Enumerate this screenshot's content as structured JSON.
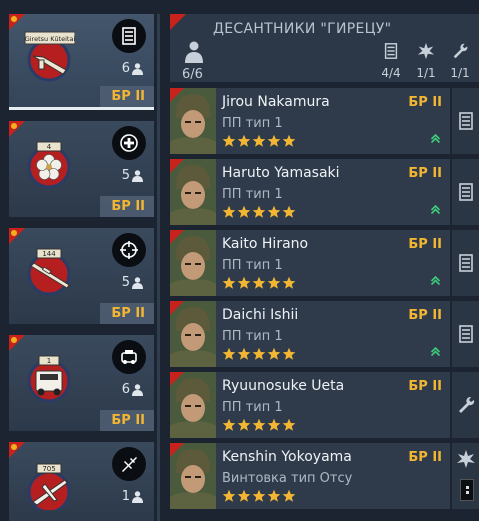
{
  "squads": [
    {
      "banner": "Giretsu Kūteitai",
      "count": "6",
      "br": "БР II",
      "role_icon": "list-icon",
      "selected": true
    },
    {
      "banner": "4",
      "count": "5",
      "br": "БР II",
      "role_icon": "medic-cross-icon",
      "selected": false
    },
    {
      "banner": "144",
      "count": "5",
      "br": "БР II",
      "role_icon": "crosshair-icon",
      "selected": false
    },
    {
      "banner": "1",
      "count": "6",
      "br": "БР II",
      "role_icon": "vehicle-icon",
      "selected": false
    },
    {
      "banner": "705",
      "count": "1",
      "br": "",
      "role_icon": "aircraft-icon",
      "selected": false
    }
  ],
  "header": {
    "title": "ДЕСАНТНИКИ \"ГИРЕЦУ\"",
    "count": "6/6",
    "stats": [
      {
        "icon": "list-icon",
        "value": "4/4"
      },
      {
        "icon": "explosion-icon",
        "value": "1/1"
      },
      {
        "icon": "wrench-icon",
        "value": "1/1"
      }
    ]
  },
  "soldiers": [
    {
      "name": "Jirou Nakamura",
      "weapon": "ПП тип 1",
      "br": "БР II",
      "stars": 5,
      "side_icon": "list-icon",
      "can_upgrade": true
    },
    {
      "name": "Haruto Yamasaki",
      "weapon": "ПП тип 1",
      "br": "БР II",
      "stars": 5,
      "side_icon": "list-icon",
      "can_upgrade": true
    },
    {
      "name": "Kaito Hirano",
      "weapon": "ПП тип 1",
      "br": "БР II",
      "stars": 5,
      "side_icon": "list-icon",
      "can_upgrade": true
    },
    {
      "name": "Daichi Ishii",
      "weapon": "ПП тип 1",
      "br": "БР II",
      "stars": 5,
      "side_icon": "list-icon",
      "can_upgrade": true
    },
    {
      "name": "Ryuunosuke Ueta",
      "weapon": "ПП тип 1",
      "br": "БР II",
      "stars": 5,
      "side_icon": "wrench-icon",
      "can_upgrade": false
    },
    {
      "name": "Kenshin Yokoyama",
      "weapon": "Винтовка тип Отсу",
      "br": "БР II",
      "stars": 5,
      "side_icon": "explosion-icon",
      "can_upgrade": false
    }
  ],
  "colors": {
    "accent": "#f2b632",
    "upgrade": "#3ecf7a",
    "flag_red": "#c8221c"
  }
}
